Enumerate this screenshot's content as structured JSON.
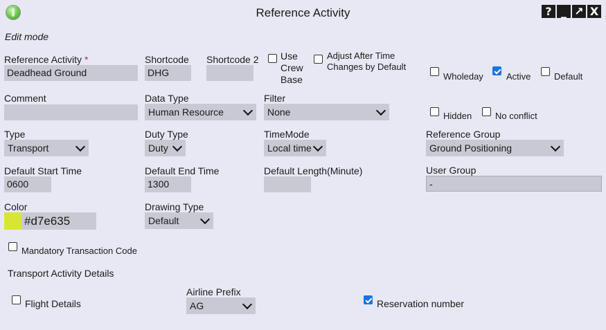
{
  "window": {
    "title": "Reference Activity",
    "mode": "Edit mode",
    "help_glyph": "?",
    "minimize_glyph": "_",
    "maximize_glyph": "↗",
    "close_glyph": "X"
  },
  "fields": {
    "reference_activity": {
      "label": "Reference Activity",
      "required_mark": "*",
      "value": "Deadhead Ground"
    },
    "shortcode": {
      "label": "Shortcode",
      "value": "DHG"
    },
    "shortcode2": {
      "label": "Shortcode 2",
      "value": ""
    },
    "use_crew_base": {
      "label_line1": "Use",
      "label_line2": "Crew",
      "label_line3": "Base",
      "checked": false
    },
    "adjust_after_time": {
      "label_line1": "Adjust After Time",
      "label_line2": "Changes by Default",
      "checked": false
    },
    "wholeday": {
      "label": "Wholeday",
      "checked": false
    },
    "active": {
      "label": "Active",
      "checked": true
    },
    "default": {
      "label": "Default",
      "checked": false
    },
    "comment": {
      "label": "Comment",
      "value": ""
    },
    "data_type": {
      "label": "Data Type",
      "value": "Human Resource"
    },
    "filter": {
      "label": "Filter",
      "value": "None"
    },
    "hidden": {
      "label": "Hidden",
      "checked": false
    },
    "no_conflict": {
      "label": "No conflict",
      "checked": false
    },
    "type": {
      "label": "Type",
      "value": "Transport"
    },
    "duty_type": {
      "label": "Duty Type",
      "value": "Duty"
    },
    "time_mode": {
      "label": "TimeMode",
      "value": "Local time"
    },
    "reference_group": {
      "label": "Reference Group",
      "value": "Ground Positioning"
    },
    "default_start_time": {
      "label": "Default Start Time",
      "value": "0600"
    },
    "default_end_time": {
      "label": "Default End Time",
      "value": "1300"
    },
    "default_length": {
      "label": "Default Length(Minute)",
      "value": ""
    },
    "user_group": {
      "label": "User Group",
      "value": "-"
    },
    "color": {
      "label": "Color",
      "value": "#d7e635",
      "swatch": "#d7e635"
    },
    "drawing_type": {
      "label": "Drawing Type",
      "value": "Default"
    },
    "mandatory_transaction_code": {
      "label": "Mandatory Transaction Code",
      "checked": false
    }
  },
  "transport": {
    "section_title": "Transport Activity Details",
    "flight_details": {
      "label": "Flight Details",
      "checked": false
    },
    "airline_prefix": {
      "label": "Airline Prefix",
      "value": "AG"
    },
    "reservation_number": {
      "label": "Reservation number",
      "checked": true
    }
  },
  "colors": {
    "background": "#e8e8f4",
    "field": "#c9c9d4",
    "checkbox_checked": "#1a73e8"
  }
}
